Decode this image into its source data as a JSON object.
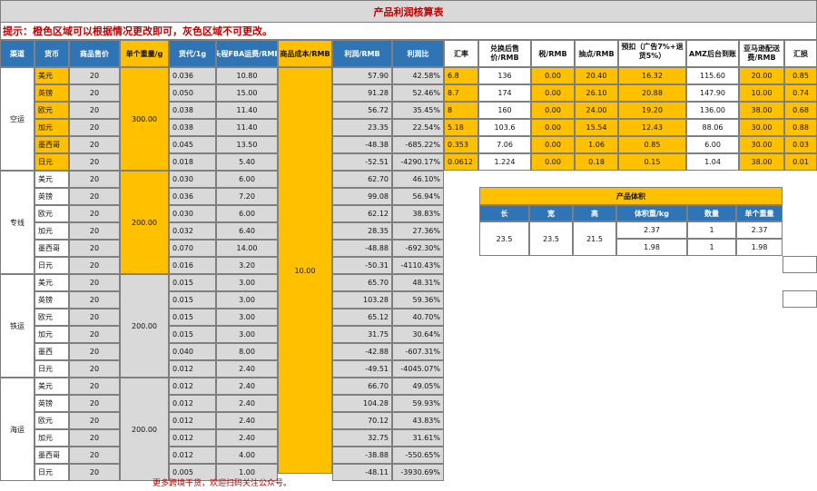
{
  "title": "产品利润核算表",
  "tip": "提示：橙色区域可以根据情况更改即可，灰色区域不可更改。",
  "headers": [
    "渠道",
    "货币",
    "商品售价",
    "单个重量/g",
    "货代/1g",
    "头程FBA运费/RMB",
    "商品成本/RMB",
    "利润/RMB",
    "利润比"
  ],
  "right_headers": [
    "汇率",
    "兑换后售价/RMB",
    "税/RMB",
    "抽点/RMB",
    "预扣（广告7%+退货5%）",
    "AMZ后台到账",
    "亚马逊配送费/RMB",
    "汇损"
  ],
  "cost": "10.00",
  "groups": [
    {
      "channel": "空运",
      "weight": "300.00",
      "rows": [
        {
          "cur": "美元",
          "price": "20",
          "rate": "0.036",
          "fba": "10.80",
          "profit": "57.90",
          "ratio": "42.58%"
        },
        {
          "cur": "英镑",
          "price": "20",
          "rate": "0.050",
          "fba": "15.00",
          "profit": "91.28",
          "ratio": "52.46%"
        },
        {
          "cur": "欧元",
          "price": "20",
          "rate": "0.038",
          "fba": "11.40",
          "profit": "56.72",
          "ratio": "35.45%"
        },
        {
          "cur": "加元",
          "price": "20",
          "rate": "0.038",
          "fba": "11.40",
          "profit": "23.35",
          "ratio": "22.54%"
        },
        {
          "cur": "墨西哥",
          "price": "20",
          "rate": "0.045",
          "fba": "13.50",
          "profit": "-48.38",
          "ratio": "-685.22%"
        },
        {
          "cur": "日元",
          "price": "20",
          "rate": "0.018",
          "fba": "5.40",
          "profit": "-52.51",
          "ratio": "-4290.17%"
        }
      ]
    },
    {
      "channel": "专线",
      "weight": "200.00",
      "rows": [
        {
          "cur": "美元",
          "price": "20",
          "rate": "0.030",
          "fba": "6.00",
          "profit": "62.70",
          "ratio": "46.10%"
        },
        {
          "cur": "英镑",
          "price": "20",
          "rate": "0.036",
          "fba": "7.20",
          "profit": "99.08",
          "ratio": "56.94%"
        },
        {
          "cur": "欧元",
          "price": "20",
          "rate": "0.030",
          "fba": "6.00",
          "profit": "62.12",
          "ratio": "38.83%"
        },
        {
          "cur": "加元",
          "price": "20",
          "rate": "0.032",
          "fba": "6.40",
          "profit": "28.35",
          "ratio": "27.36%"
        },
        {
          "cur": "墨西哥",
          "price": "20",
          "rate": "0.070",
          "fba": "14.00",
          "profit": "-48.88",
          "ratio": "-692.30%"
        },
        {
          "cur": "日元",
          "price": "20",
          "rate": "0.016",
          "fba": "3.20",
          "profit": "-50.31",
          "ratio": "-4110.43%"
        }
      ]
    },
    {
      "channel": "铁运",
      "weight": "200.00",
      "rows": [
        {
          "cur": "美元",
          "price": "20",
          "rate": "0.015",
          "fba": "3.00",
          "profit": "65.70",
          "ratio": "48.31%"
        },
        {
          "cur": "英镑",
          "price": "20",
          "rate": "0.015",
          "fba": "3.00",
          "profit": "103.28",
          "ratio": "59.36%"
        },
        {
          "cur": "欧元",
          "price": "20",
          "rate": "0.015",
          "fba": "3.00",
          "profit": "65.12",
          "ratio": "40.70%"
        },
        {
          "cur": "加元",
          "price": "20",
          "rate": "0.015",
          "fba": "3.00",
          "profit": "31.75",
          "ratio": "30.64%"
        },
        {
          "cur": "墨西",
          "price": "20",
          "rate": "0.040",
          "fba": "8.00",
          "profit": "-42.88",
          "ratio": "-607.31%"
        },
        {
          "cur": "日元",
          "price": "20",
          "rate": "0.012",
          "fba": "2.40",
          "profit": "-49.51",
          "ratio": "-4045.07%"
        }
      ]
    },
    {
      "channel": "海运",
      "weight": "200.00",
      "rows": [
        {
          "cur": "美元",
          "price": "20",
          "rate": "0.012",
          "fba": "2.40",
          "profit": "66.70",
          "ratio": "49.05%"
        },
        {
          "cur": "英镑",
          "price": "20",
          "rate": "0.012",
          "fba": "2.40",
          "profit": "104.28",
          "ratio": "59.93%"
        },
        {
          "cur": "欧元",
          "price": "20",
          "rate": "0.012",
          "fba": "2.40",
          "profit": "70.12",
          "ratio": "43.83%"
        },
        {
          "cur": "加元",
          "price": "20",
          "rate": "0.012",
          "fba": "2.40",
          "profit": "32.75",
          "ratio": "31.61%"
        },
        {
          "cur": "墨西哥",
          "price": "20",
          "rate": "0.012",
          "fba": "4.00",
          "profit": "-38.88",
          "ratio": "-550.65%"
        },
        {
          "cur": "日元",
          "price": "20",
          "rate": "0.005",
          "fba": "1.00",
          "profit": "-48.11",
          "ratio": "-3930.69%"
        }
      ]
    }
  ],
  "right_rows": [
    {
      "fx": "6.8",
      "conv": "136",
      "tax": "0.00",
      "comm": "20.40",
      "pre": "16.32",
      "amz": "115.60",
      "ship": "20.00",
      "loss": "0.85"
    },
    {
      "fx": "8.7",
      "conv": "174",
      "tax": "0.00",
      "comm": "26.10",
      "pre": "20.88",
      "amz": "147.90",
      "ship": "10.00",
      "loss": "0.74"
    },
    {
      "fx": "8",
      "conv": "160",
      "tax": "0.00",
      "comm": "24.00",
      "pre": "19.20",
      "amz": "136.00",
      "ship": "38.00",
      "loss": "0.68"
    },
    {
      "fx": "5.18",
      "conv": "103.6",
      "tax": "0.00",
      "comm": "15.54",
      "pre": "12.43",
      "amz": "88.06",
      "ship": "30.00",
      "loss": "0.88"
    },
    {
      "fx": "0.353",
      "conv": "7.06",
      "tax": "0.00",
      "comm": "1.06",
      "pre": "0.85",
      "amz": "6.00",
      "ship": "30.00",
      "loss": "0.03"
    },
    {
      "fx": "0.0612",
      "conv": "1.224",
      "tax": "0.00",
      "comm": "0.18",
      "pre": "0.15",
      "amz": "1.04",
      "ship": "38.00",
      "loss": "0.01"
    }
  ],
  "volume": {
    "title": "产品体积",
    "headers": [
      "长",
      "宽",
      "高",
      "体积重/kg",
      "数量",
      "单个重量"
    ],
    "l": "23.5",
    "w": "23.5",
    "h": "21.5",
    "rows": [
      {
        "vw": "2.37",
        "qty": "1",
        "unit": "2.37"
      },
      {
        "vw": "1.98",
        "qty": "1",
        "unit": "1.98"
      }
    ]
  },
  "footer": "更多跨境干货，欢迎扫码关注公众号。"
}
